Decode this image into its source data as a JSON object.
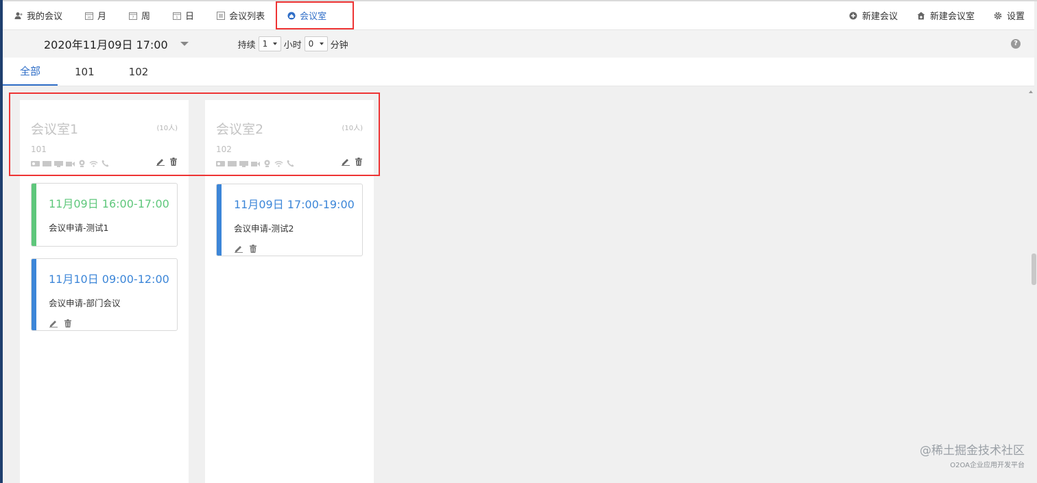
{
  "nav": {
    "left": [
      {
        "label": "我的会议",
        "icon": "user-icon"
      },
      {
        "label": "月",
        "icon": "calendar-month-icon"
      },
      {
        "label": "周",
        "icon": "calendar-week-icon"
      },
      {
        "label": "日",
        "icon": "calendar-day-icon"
      },
      {
        "label": "会议列表",
        "icon": "list-icon"
      },
      {
        "label": "会议室",
        "icon": "room-icon"
      }
    ],
    "right": [
      {
        "label": "新建会议",
        "icon": "plus-circle-icon"
      },
      {
        "label": "新建会议室",
        "icon": "add-room-icon"
      },
      {
        "label": "设置",
        "icon": "gear-icon"
      }
    ]
  },
  "toolbar": {
    "datetime": "2020年11月09日 17:00",
    "duration_label": "持续",
    "hours_value": "1",
    "hours_unit": "小时",
    "minutes_value": "0",
    "minutes_unit": "分钟"
  },
  "tabs": [
    "全部",
    "101",
    "102"
  ],
  "rooms": [
    {
      "name": "会议室1",
      "capacity": "(10人)",
      "number": "101",
      "meetings": [
        {
          "time": "11月09日 16:00-17:00",
          "title": "会议申请-测试1",
          "color": "#5ec77b"
        },
        {
          "time": "11月10日 09:00-12:00",
          "title": "会议申请-部门会议",
          "color": "#3c86d8"
        }
      ]
    },
    {
      "name": "会议室2",
      "capacity": "(10人)",
      "number": "102",
      "meetings": [
        {
          "time": "11月09日 17:00-19:00",
          "title": "会议申请-测试2",
          "color": "#3c86d8"
        }
      ]
    }
  ],
  "colors": {
    "accent": "#2f6ec7",
    "green": "#5ec77b",
    "blue": "#3c86d8",
    "highlight": "#e33333"
  },
  "watermark": {
    "main": "@稀土掘金技术社区",
    "sub": "O2OA企业应用开发平台"
  }
}
